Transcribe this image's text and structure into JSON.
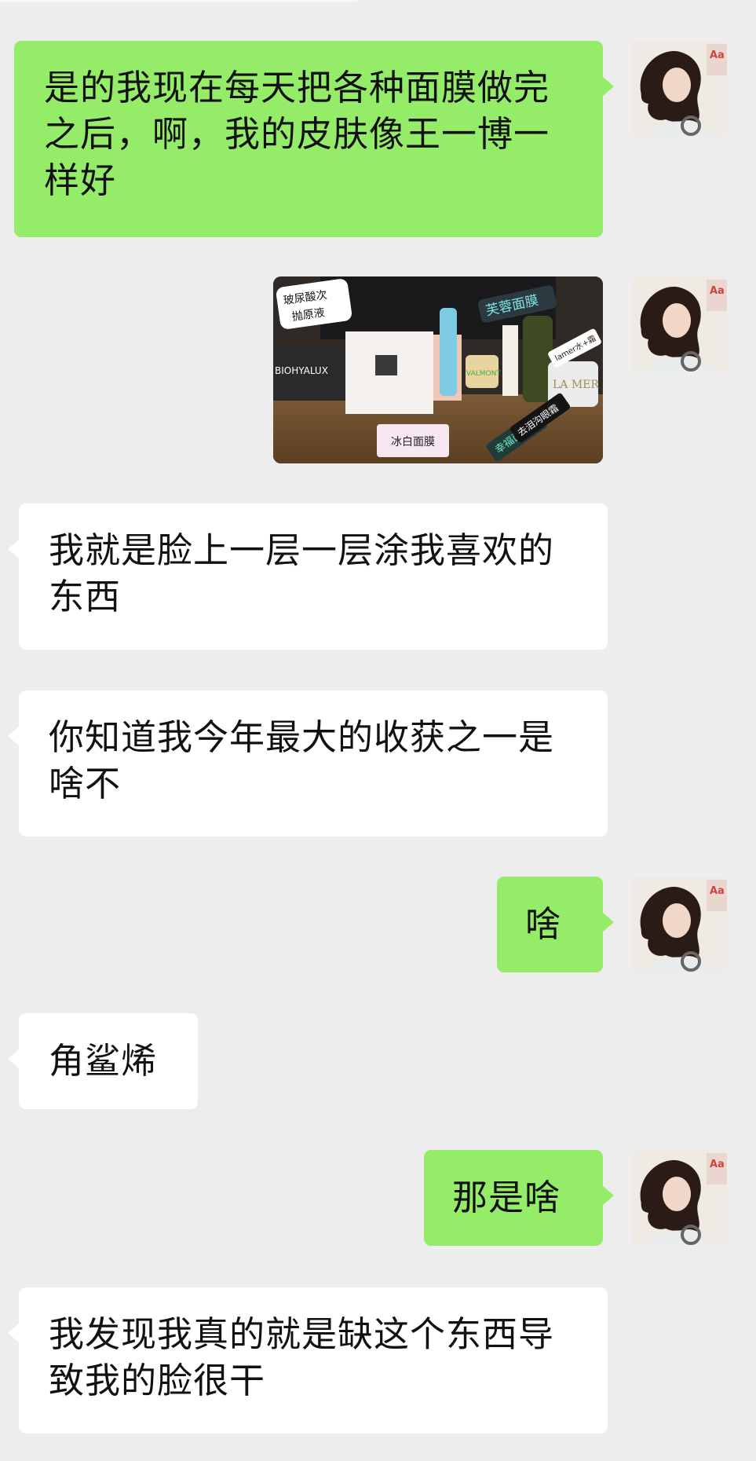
{
  "chat": {
    "messages": [
      {
        "side": "out",
        "type": "text",
        "text": "是的我现在每天把各种面膜做完之后，啊，我的皮肤像王一博一样好"
      },
      {
        "side": "out",
        "type": "image",
        "labels": {
          "tag1_line1": "玻尿酸次",
          "tag1_line2": "抛原液",
          "tag2": "芙蓉面膜",
          "tag3": "冰白面膜",
          "tag4": "幸福面膜",
          "tag5": "去泪沟眼霜",
          "tag6": "lamer水+霜",
          "brand1": "BIOHYALUX",
          "brand2": "LA MER",
          "brand3": "VALMONT"
        }
      },
      {
        "side": "in",
        "type": "text",
        "text": "我就是脸上一层一层涂我喜欢的东西"
      },
      {
        "side": "in",
        "type": "text",
        "text": "你知道我今年最大的收获之一是啥不"
      },
      {
        "side": "out",
        "type": "text",
        "text": "啥"
      },
      {
        "side": "in",
        "type": "text",
        "text": "角鲨烯"
      },
      {
        "side": "out",
        "type": "text",
        "text": "那是啥"
      },
      {
        "side": "in",
        "type": "text",
        "text": "我发现我真的就是缺这个东西导致我的脸很干"
      }
    ]
  },
  "colors": {
    "background": "#ededed",
    "outgoing_bubble": "#95ec69",
    "incoming_bubble": "#ffffff",
    "text": "#111111"
  },
  "icons": {
    "avatar": "user-avatar-photo"
  }
}
